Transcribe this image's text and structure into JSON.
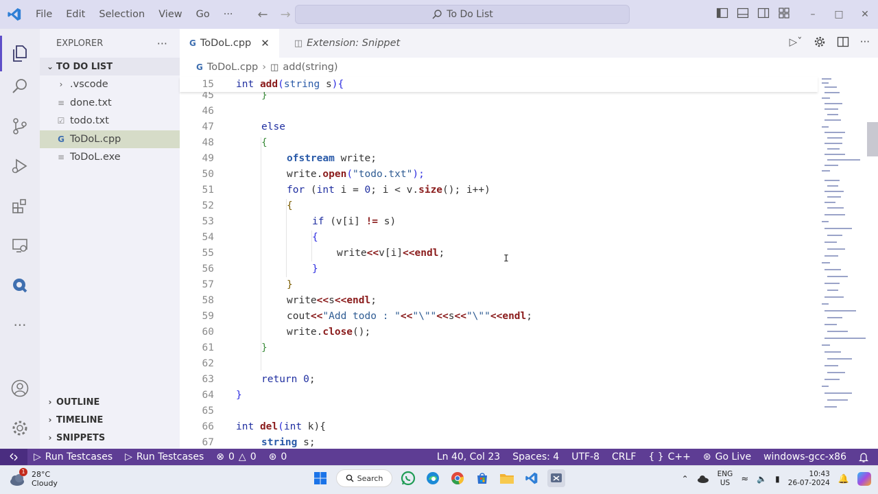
{
  "titlebar": {
    "menu": [
      "File",
      "Edit",
      "Selection",
      "View",
      "Go",
      "···"
    ],
    "search": "To Do List"
  },
  "sidebar": {
    "header": "EXPLORER",
    "more": "···",
    "root": "TO DO LIST",
    "items": [
      {
        "label": ".vscode",
        "icon": "chevron-right"
      },
      {
        "label": "done.txt",
        "icon": "lines"
      },
      {
        "label": "todo.txt",
        "icon": "checkbox"
      },
      {
        "label": "ToDoL.cpp",
        "icon": "cpp"
      },
      {
        "label": "ToDoL.exe",
        "icon": "lines"
      }
    ],
    "sections": [
      "OUTLINE",
      "TIMELINE",
      "SNIPPETS"
    ]
  },
  "tabs": [
    {
      "label": "ToDoL.cpp",
      "active": true
    },
    {
      "label": "Extension: Snippet",
      "active": false
    }
  ],
  "breadcrumb": {
    "file": "ToDoL.cpp",
    "symbol": "add(string)"
  },
  "sticky": {
    "ln": "15",
    "code": "int add(string s){"
  },
  "lines": [
    {
      "ln": "45"
    },
    {
      "ln": "46"
    },
    {
      "ln": "47"
    },
    {
      "ln": "48"
    },
    {
      "ln": "49"
    },
    {
      "ln": "50"
    },
    {
      "ln": "51"
    },
    {
      "ln": "52"
    },
    {
      "ln": "53"
    },
    {
      "ln": "54"
    },
    {
      "ln": "55"
    },
    {
      "ln": "56"
    },
    {
      "ln": "57"
    },
    {
      "ln": "58"
    },
    {
      "ln": "59"
    },
    {
      "ln": "60"
    },
    {
      "ln": "61"
    },
    {
      "ln": "62"
    },
    {
      "ln": "63"
    },
    {
      "ln": "64"
    },
    {
      "ln": "65"
    },
    {
      "ln": "66"
    },
    {
      "ln": "67"
    }
  ],
  "code": {
    "l45": "}",
    "l47": "else",
    "l48": "{",
    "l49a": "ofstream",
    "l49b": " write;",
    "l50a": "write.",
    "l50b": "open",
    "l50c": "(",
    "l50d": "\"todo.txt\"",
    "l50e": ");",
    "l51a": "for",
    "l51b": " (",
    "l51c": "int",
    "l51d": " i = ",
    "l51e": "0",
    "l51f": "; i < v.",
    "l51g": "size",
    "l51h": "(); i++)",
    "l52": "{",
    "l53a": "if",
    "l53b": " (v[i] ",
    "l53c": "!=",
    "l53d": " s)",
    "l54": "{",
    "l55a": "write",
    "l55b": "<<",
    "l55c": "v[i]",
    "l55d": "<<",
    "l55e": "endl",
    "l55f": ";",
    "l56": "}",
    "l57": "}",
    "l58a": "write",
    "l58b": "<<",
    "l58c": "s",
    "l58d": "<<",
    "l58e": "endl",
    "l58f": ";",
    "l59a": "cout",
    "l59b": "<<",
    "l59c": "\"Add todo : \"",
    "l59d": "<<",
    "l59e": "\"\\\"\"",
    "l59f": "<<",
    "l59g": "s",
    "l59h": "<<",
    "l59i": "\"\\\"\"",
    "l59j": "<<",
    "l59k": "endl",
    "l59l": ";",
    "l60a": "write.",
    "l60b": "close",
    "l60c": "();",
    "l61": "}",
    "l63a": "return",
    "l63b": " ",
    "l63c": "0",
    "l63d": ";",
    "l64": "}",
    "l66a": "int",
    "l66b": " ",
    "l66c": "del",
    "l66d": "(",
    "l66e": "int",
    "l66f": " k){",
    "l67a": "string",
    "l67b": " s;"
  },
  "statusbar": {
    "run1": "Run Testcases",
    "run2": "Run Testcases",
    "errors": "0",
    "warnings": "0",
    "ports": "0",
    "position": "Ln 40, Col 23",
    "spaces": "Spaces: 4",
    "encoding": "UTF-8",
    "eol": "CRLF",
    "language": "C++",
    "golive": "Go Live",
    "compiler": "windows-gcc-x86"
  },
  "taskbar": {
    "temp": "28°C",
    "weather": "Cloudy",
    "badge": "1",
    "search": "Search",
    "lang1": "ENG",
    "lang2": "US",
    "time": "10:43",
    "date": "26-07-2024"
  },
  "colors": {
    "statusbar": "#5e3d94",
    "titlebar": "#ddddf1",
    "accent": "#5e4fc8"
  }
}
